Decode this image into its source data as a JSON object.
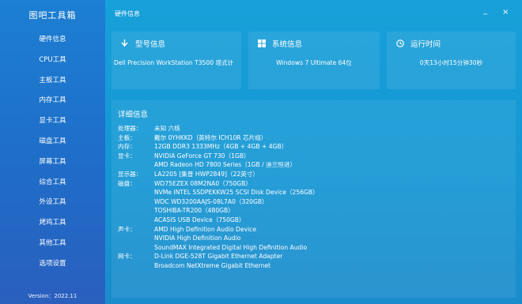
{
  "app": {
    "title": "图吧工具箱",
    "version": "Version：2022.11"
  },
  "sidebar": {
    "items": [
      {
        "label": "硬件信息"
      },
      {
        "label": "CPU工具"
      },
      {
        "label": "主板工具"
      },
      {
        "label": "内存工具"
      },
      {
        "label": "显卡工具"
      },
      {
        "label": "磁盘工具"
      },
      {
        "label": "屏幕工具"
      },
      {
        "label": "综合工具"
      },
      {
        "label": "外设工具"
      },
      {
        "label": "烤鸡工具"
      },
      {
        "label": "其他工具"
      },
      {
        "label": "选项设置"
      }
    ]
  },
  "window": {
    "title": "硬件信息",
    "minimize": "_",
    "close": "×"
  },
  "cards": {
    "model": {
      "title": "型号信息",
      "value": "Dell Precision WorkStation T3500 塔式计"
    },
    "system": {
      "title": "系统信息",
      "value": "Windows 7 Ultimate 64位"
    },
    "uptime": {
      "title": "运行时间",
      "value": "0天13小时15分钟30秒"
    }
  },
  "detail": {
    "title": "详细信息",
    "rows": [
      {
        "key": "处理器：",
        "value": "未知 六核"
      },
      {
        "key": "主板：",
        "value": "戴尔 0YHKKD（英特尔 ICH10R 芯片组）"
      },
      {
        "key": "内存：",
        "value": "12GB DDR3 1333MHz（4GB + 4GB + 4GB）"
      },
      {
        "key": "显卡：",
        "value": "NVIDIA GeForce GT 730（1GB）"
      },
      {
        "key": "",
        "value": "AMD Radeon HD 7800 Series（1GB / 迪兰恒进）"
      },
      {
        "key": "显示器：",
        "value": "LA2205 [集普 HWP2849]（22英寸）"
      },
      {
        "key": "磁盘：",
        "value": "WD75EZEX 08M2NA0（750GB）"
      },
      {
        "key": "",
        "value": "NVMe INTEL SSDPEKKW25 SCSI Disk Device（256GB）"
      },
      {
        "key": "",
        "value": "WDC WD3200AAJS-08L7A0（320GB）"
      },
      {
        "key": "",
        "value": "TOSHIBA-TR200（480GB）"
      },
      {
        "key": "",
        "value": "ACASIS USB Device（750GB）"
      },
      {
        "key": "声卡：",
        "value": "AMD High Definition Audio Device"
      },
      {
        "key": "",
        "value": "NVIDIA High Definition Audio"
      },
      {
        "key": "",
        "value": "SoundMAX Integrated Digital High Definition Audio"
      },
      {
        "key": "网卡：",
        "value": "D-Link DGE-528T Gigabit Ethernet Adapter"
      },
      {
        "key": "",
        "value": "Broadcom NetXtreme Gigabit Ethernet"
      }
    ]
  },
  "icons": {
    "model": "download-arrow-icon",
    "system": "windows-logo-icon",
    "uptime": "clock-icon"
  }
}
